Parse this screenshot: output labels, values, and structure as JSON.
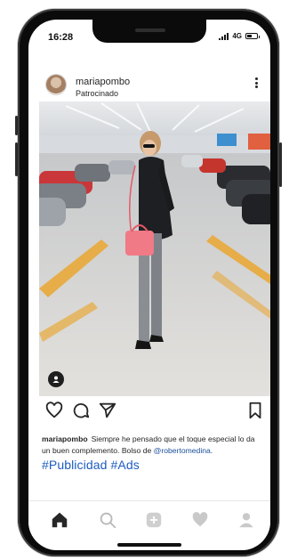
{
  "status_bar": {
    "time": "16:28",
    "network": "4G"
  },
  "post": {
    "username": "mariapombo",
    "sponsored_label": "Patrocinado",
    "more_icon": "more-vertical-icon",
    "image_description_icon": "person-tag-icon"
  },
  "actions": {
    "like_icon": "heart-icon",
    "comment_icon": "comment-icon",
    "share_icon": "send-icon",
    "save_icon": "bookmark-icon"
  },
  "caption": {
    "username": "mariapombo",
    "text": "Siempre he pensado que el toque especial lo da un buen complemento. Bolso de ",
    "mention": "@robertomedina",
    "text_end": ".",
    "hashtag_1": "#Publicidad",
    "hashtag_2": "#Ads"
  },
  "bottom_nav": {
    "items": [
      "home-icon",
      "search-icon",
      "add-post-icon",
      "activity-heart-icon",
      "profile-icon"
    ]
  },
  "colors": {
    "hashtag": "#1e5cc0",
    "mention": "#1a4f9a",
    "text": "#262626",
    "bag": "#f07a86"
  }
}
